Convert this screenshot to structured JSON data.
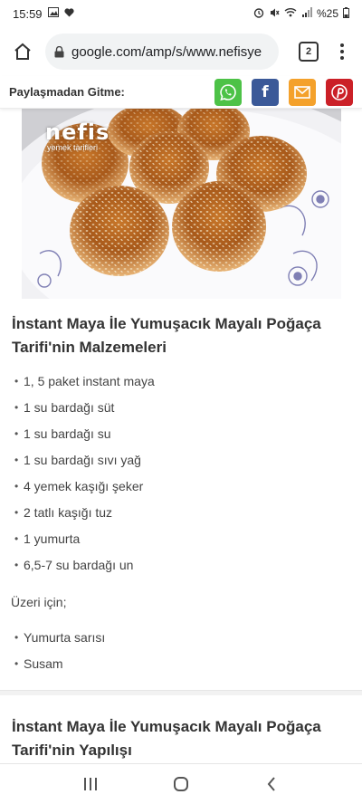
{
  "status_bar": {
    "time": "15:59",
    "battery": "%25"
  },
  "browser": {
    "url": "google.com/amp/s/www.nefisye",
    "tab_count": "2"
  },
  "share_bar": {
    "label": "Paylaşmadan Gitme:",
    "buttons": [
      {
        "name": "whatsapp",
        "color": "#4dc247"
      },
      {
        "name": "facebook",
        "color": "#3b5998",
        "glyph": "f"
      },
      {
        "name": "email",
        "color": "#f4a12b"
      },
      {
        "name": "pinterest",
        "color": "#cb2027"
      }
    ]
  },
  "recipe_image": {
    "watermark_line1": "nefis",
    "watermark_line2": "yemek tarifleri"
  },
  "ingredients_section": {
    "title": "İnstant Maya İle Yumuşacık Mayalı Poğaça Tarifi'nin Malzemeleri",
    "items": [
      "1, 5 paket instant maya",
      "1 su bardağı süt",
      "1 su bardağı su",
      "1 su bardağı sıvı yağ",
      "4 yemek kaşığı şeker",
      "2 tatlı kaşığı tuz",
      "1 yumurta",
      "6,5-7 su bardağı un"
    ],
    "topping_label": "Üzeri için;",
    "topping_items": [
      "Yumurta sarısı",
      "Susam"
    ]
  },
  "method_section": {
    "title": "İnstant Maya İle Yumuşacık Mayalı Poğaça Tarifi'nin Yapılışı"
  },
  "bullet": "•"
}
